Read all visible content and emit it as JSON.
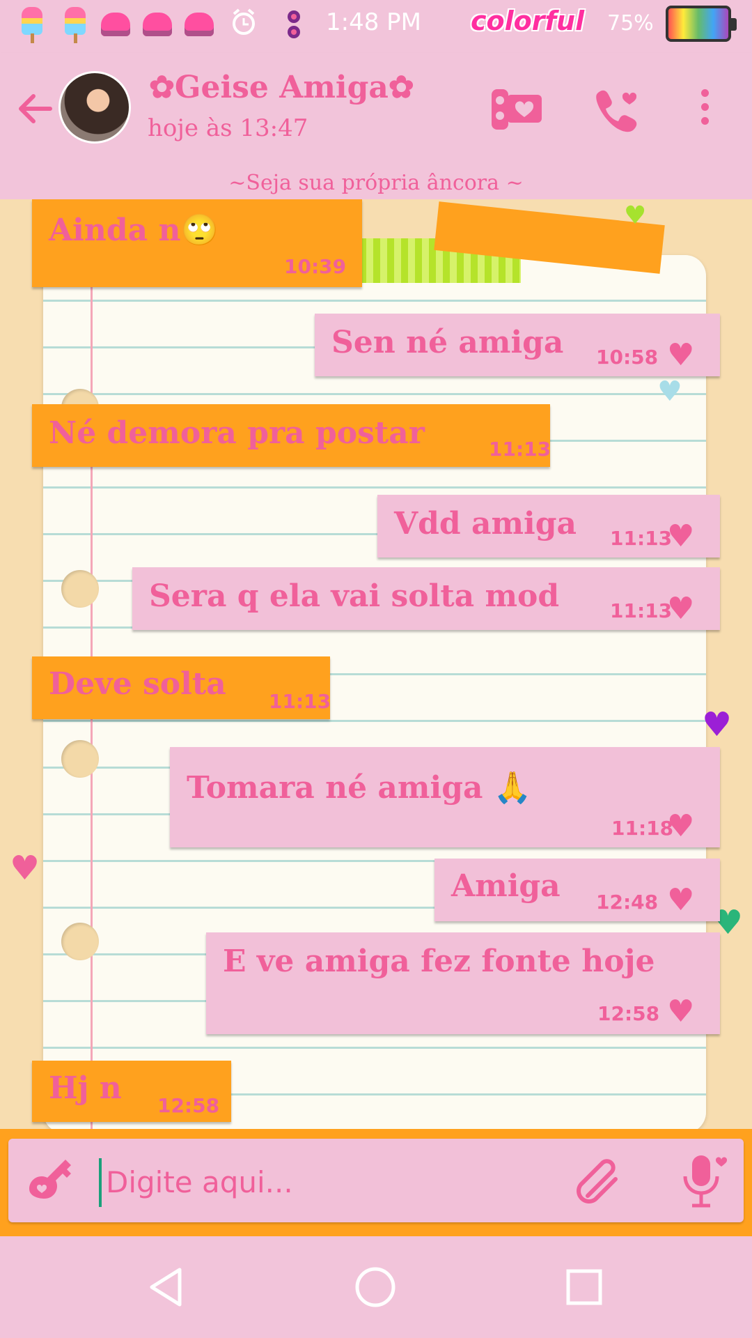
{
  "status_bar": {
    "time": "1:48 PM",
    "brand": "colorful",
    "battery": "75%",
    "notification_icons": [
      "popsicle-icon",
      "popsicle-icon",
      "cupcake-icon",
      "cupcake-icon",
      "cupcake-icon",
      "alarm-icon",
      "bow-icon"
    ]
  },
  "header": {
    "contact_name": "✿Geise Amiga✿",
    "last_seen": "hoje às 13:47",
    "motto": "~Seja sua própria âncora ~"
  },
  "messages": [
    {
      "dir": "in",
      "text": "Ainda n🙄",
      "time": "10:39"
    },
    {
      "dir": "out",
      "text": "Sen né amiga",
      "time": "10:58"
    },
    {
      "dir": "in",
      "text": "Né demora pra postar",
      "time": "11:13"
    },
    {
      "dir": "out",
      "text": "Vdd amiga",
      "time": "11:13"
    },
    {
      "dir": "out",
      "text": "Sera q ela vai solta mod",
      "time": "11:13"
    },
    {
      "dir": "in",
      "text": "Deve solta",
      "time": "11:13"
    },
    {
      "dir": "out",
      "text": "Tomara né amiga 🙏",
      "time": "11:18"
    },
    {
      "dir": "out",
      "text": "Amiga",
      "time": "12:48"
    },
    {
      "dir": "out",
      "text": "E ve amiga fez fonte hoje",
      "time": "12:58"
    },
    {
      "dir": "in",
      "text": "Hj n",
      "time": "12:58"
    }
  ],
  "input": {
    "placeholder": "Digite aqui..."
  },
  "colors": {
    "pink_bg": "#f2c4da",
    "pink_text": "#f0609a",
    "orange_bubble": "#ffa11e",
    "pink_bubble": "#f2c0d8"
  }
}
